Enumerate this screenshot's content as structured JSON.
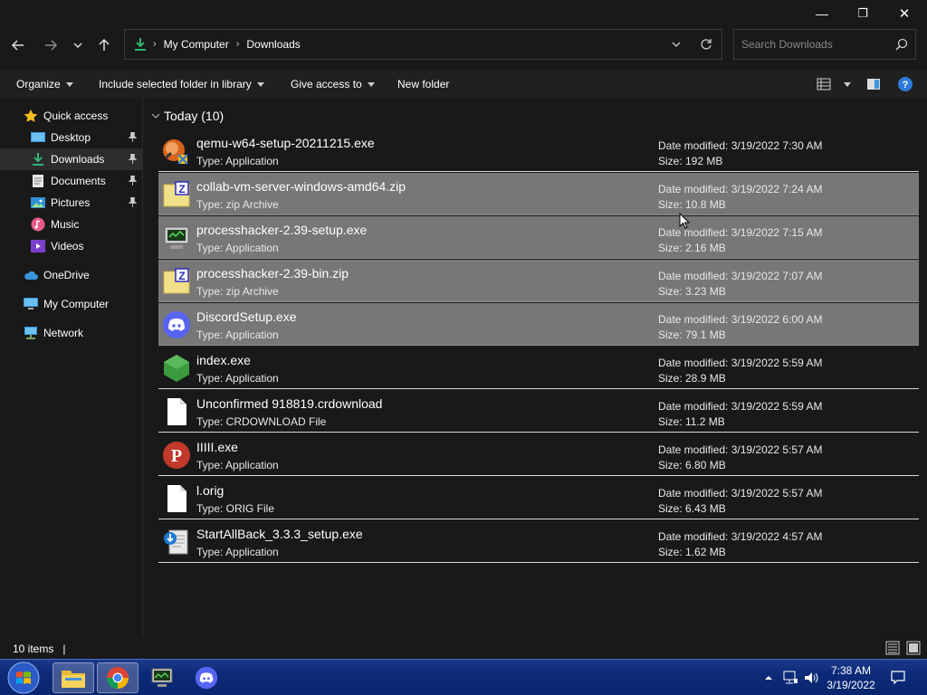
{
  "window": {
    "minimize": "—",
    "maximize": "❐",
    "close": "✕"
  },
  "address": {
    "crumbs": [
      "My Computer",
      "Downloads"
    ]
  },
  "search": {
    "placeholder": "Search Downloads"
  },
  "toolbar": {
    "organize": "Organize",
    "include_library": "Include selected folder in library",
    "give_access": "Give access to",
    "new_folder": "New folder"
  },
  "sidebar": {
    "items": [
      {
        "label": "Quick access"
      },
      {
        "label": "Desktop"
      },
      {
        "label": "Downloads"
      },
      {
        "label": "Documents"
      },
      {
        "label": "Pictures"
      },
      {
        "label": "Music"
      },
      {
        "label": "Videos"
      },
      {
        "label": "OneDrive"
      },
      {
        "label": "My Computer"
      },
      {
        "label": "Network"
      }
    ]
  },
  "group": {
    "label": "Today (10)"
  },
  "files": [
    {
      "name": "qemu-w64-setup-20211215.exe",
      "type": "Type: Application",
      "date": "Date modified: 3/19/2022 7:30 AM",
      "size": "Size: 192 MB"
    },
    {
      "name": "collab-vm-server-windows-amd64.zip",
      "type": "Type: zip Archive",
      "date": "Date modified: 3/19/2022 7:24 AM",
      "size": "Size: 10.8 MB"
    },
    {
      "name": "processhacker-2.39-setup.exe",
      "type": "Type: Application",
      "date": "Date modified: 3/19/2022 7:15 AM",
      "size": "Size: 2.16 MB"
    },
    {
      "name": "processhacker-2.39-bin.zip",
      "type": "Type: zip Archive",
      "date": "Date modified: 3/19/2022 7:07 AM",
      "size": "Size: 3.23 MB"
    },
    {
      "name": "DiscordSetup.exe",
      "type": "Type: Application",
      "date": "Date modified: 3/19/2022 6:00 AM",
      "size": "Size: 79.1 MB"
    },
    {
      "name": "index.exe",
      "type": "Type: Application",
      "date": "Date modified: 3/19/2022 5:59 AM",
      "size": "Size: 28.9 MB"
    },
    {
      "name": "Unconfirmed 918819.crdownload",
      "type": "Type: CRDOWNLOAD File",
      "date": "Date modified: 3/19/2022 5:59 AM",
      "size": "Size: 11.2 MB"
    },
    {
      "name": "IIIII.exe",
      "type": "Type: Application",
      "date": "Date modified: 3/19/2022 5:57 AM",
      "size": "Size: 6.80 MB"
    },
    {
      "name": "l.orig",
      "type": "Type: ORIG File",
      "date": "Date modified: 3/19/2022 5:57 AM",
      "size": "Size: 6.43 MB"
    },
    {
      "name": "StartAllBack_3.3.3_setup.exe",
      "type": "Type: Application",
      "date": "Date modified: 3/19/2022 4:57 AM",
      "size": "Size: 1.62 MB"
    }
  ],
  "status": {
    "count": "10 items",
    "cursor": "|"
  },
  "clock": {
    "time": "7:38 AM",
    "date": "3/19/2022"
  },
  "colors": {
    "selection": "#777777",
    "taskbar": "#0c2a78",
    "accent": "#3a96dd"
  }
}
